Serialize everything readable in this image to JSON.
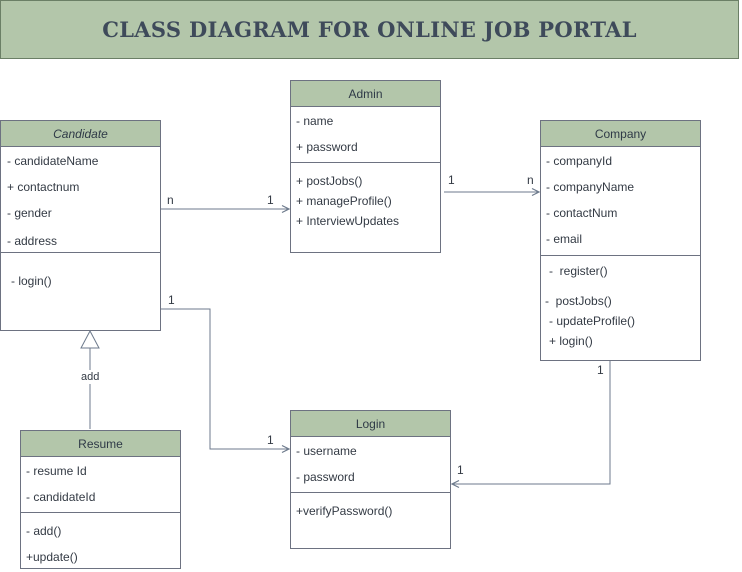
{
  "title": "CLASS DIAGRAM FOR ONLINE JOB PORTAL",
  "classes": {
    "admin": {
      "name": "Admin",
      "attributes": [
        "- name",
        "+ password"
      ],
      "methods": [
        "+ postJobs()",
        "+ manageProfile()",
        "+ InterviewUpdates"
      ]
    },
    "candidate": {
      "name": "Candidate",
      "attributes": [
        "- candidateName",
        "+ contactnum",
        "- gender",
        "- address"
      ],
      "methods": [
        "- login()"
      ]
    },
    "company": {
      "name": "Company",
      "attributes": [
        "- companyId",
        "- companyName",
        "- contactNum",
        "- email"
      ],
      "methods": [
        "-  register()",
        "-  postJobs()",
        "- updateProfile()",
        "+ login()"
      ]
    },
    "resume": {
      "name": "Resume",
      "attributes": [
        "- resume Id",
        "- candidateId"
      ],
      "methods": [
        "- add()",
        "+update()"
      ]
    },
    "login": {
      "name": "Login",
      "attributes": [
        "- username",
        "- password"
      ],
      "methods": [
        "+verifyPassword()"
      ]
    }
  },
  "relations": {
    "candidate_admin": {
      "source_mult": "n",
      "target_mult": "1"
    },
    "admin_company": {
      "source_mult": "1",
      "target_mult": "n"
    },
    "candidate_login": {
      "source_mult": "1",
      "target_mult": "1"
    },
    "company_login": {
      "source_mult": "1",
      "target_mult": "1"
    },
    "resume_candidate": {
      "label": "add"
    }
  },
  "colors": {
    "header_fill": "#b3c6aa",
    "border": "#6d7281",
    "line": "#6d7a8c",
    "title_text": "#3e4a5a"
  }
}
